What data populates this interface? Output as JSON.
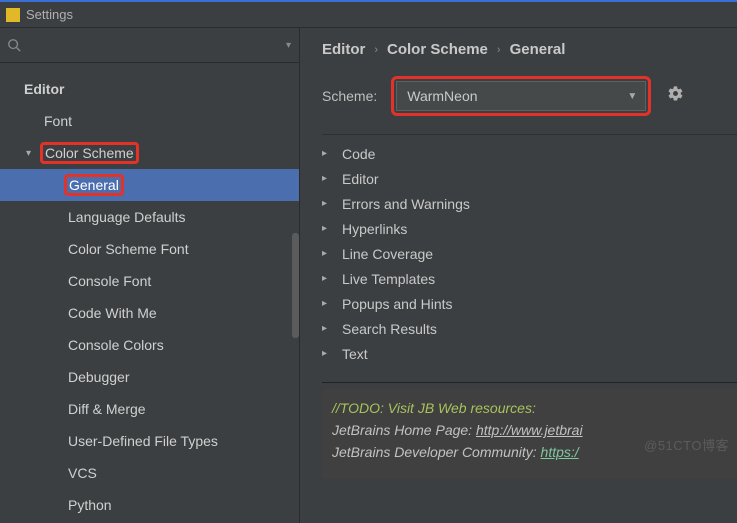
{
  "title": "Settings",
  "search": {
    "placeholder": ""
  },
  "tree": {
    "header": "Editor",
    "items": [
      {
        "label": "Font",
        "level": 1
      },
      {
        "label": "Color Scheme",
        "level": 1,
        "expanded": true,
        "highlighted": true
      },
      {
        "label": "General",
        "level": 2,
        "selected": true
      },
      {
        "label": "Language Defaults",
        "level": 2
      },
      {
        "label": "Color Scheme Font",
        "level": 2
      },
      {
        "label": "Console Font",
        "level": 2
      },
      {
        "label": "Code With Me",
        "level": 2
      },
      {
        "label": "Console Colors",
        "level": 2
      },
      {
        "label": "Debugger",
        "level": 2
      },
      {
        "label": "Diff & Merge",
        "level": 2
      },
      {
        "label": "User-Defined File Types",
        "level": 2
      },
      {
        "label": "VCS",
        "level": 2
      },
      {
        "label": "Python",
        "level": 2
      }
    ]
  },
  "breadcrumb": [
    "Editor",
    "Color Scheme",
    "General"
  ],
  "scheme": {
    "label": "Scheme:",
    "value": "WarmNeon"
  },
  "categories": [
    "Code",
    "Editor",
    "Errors and Warnings",
    "Hyperlinks",
    "Line Coverage",
    "Live Templates",
    "Popups and Hints",
    "Search Results",
    "Text"
  ],
  "preview": {
    "todo": "//TODO: Visit JB Web resources:",
    "line1a": "JetBrains Home Page: ",
    "line1b": "http://www.jetbrai",
    "line2a": "JetBrains Developer Community: ",
    "line2b": "https:/"
  },
  "watermark": "@51CTO博客"
}
